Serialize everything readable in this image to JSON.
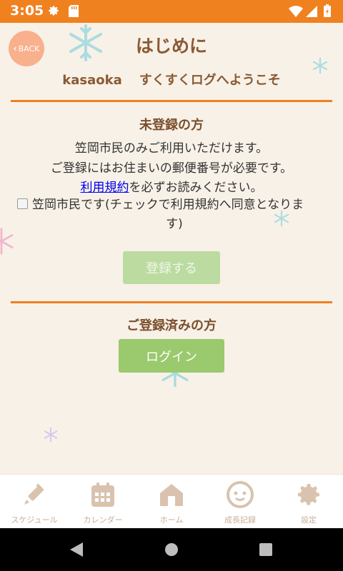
{
  "status_bar": {
    "time": "3:05"
  },
  "header": {
    "back_label": "BACK",
    "title": "はじめに",
    "welcome_brand": "kasaoka",
    "welcome_text": "すくすくログへようこそ"
  },
  "unregistered": {
    "heading": "未登録の方",
    "line1": "笠岡市民のみご利用いただけます。",
    "line2": "ご登録にはお住まいの郵便番号が必要です。",
    "terms_link": "利用規約",
    "line3_suffix": "を必ずお読みください。",
    "checkbox_label": "笠岡市民です(チェックで利用規約へ同意となりま",
    "checkbox_label_cont": "す)",
    "register_button": "登録する"
  },
  "registered": {
    "heading": "ご登録済みの方",
    "login_button": "ログイン"
  },
  "tabs": [
    {
      "label": "スケジュール",
      "icon": "syringe-icon"
    },
    {
      "label": "カレンダー",
      "icon": "calendar-icon"
    },
    {
      "label": "ホーム",
      "icon": "home-icon"
    },
    {
      "label": "成長記録",
      "icon": "baby-face-icon"
    },
    {
      "label": "設定",
      "icon": "gear-icon"
    }
  ],
  "colors": {
    "status_bar": "#f0811f",
    "accent_line": "#f0811f",
    "heading_brown": "#8a5a34",
    "login_green": "#9bc96d",
    "tab_icon": "#d9c3ae"
  }
}
